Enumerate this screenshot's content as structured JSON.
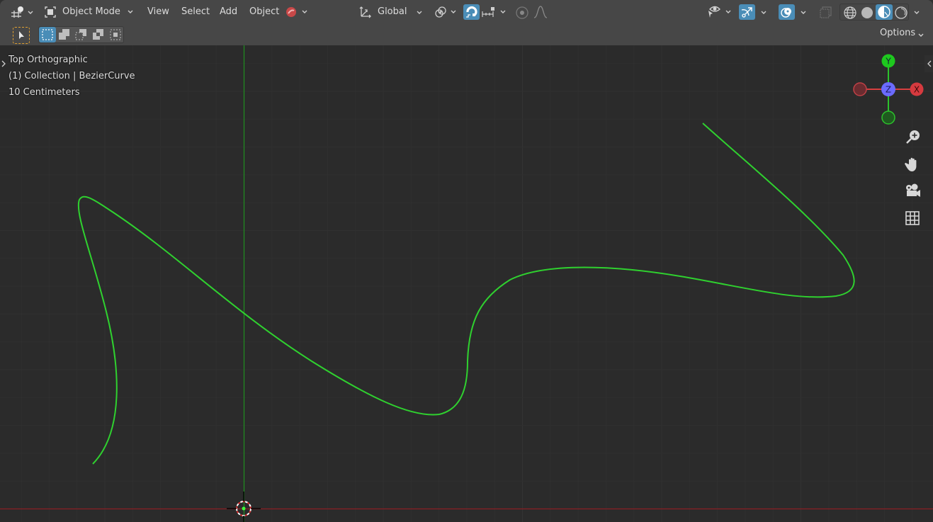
{
  "header": {
    "editor_type_icon": "viewport-editor-icon",
    "mode": {
      "label": "Object Mode",
      "icon": "object-mode-icon"
    },
    "menus": [
      "View",
      "Select",
      "Add",
      "Object"
    ],
    "transform_orientation": {
      "label": "Global",
      "icon": "orientation-icon"
    },
    "snap": {
      "active": true
    },
    "proportional_editing": {
      "active": false
    },
    "visibility_icon": "eye-icon",
    "gizmo_toggle": {
      "active": true
    },
    "overlay_toggle": {
      "active": true
    },
    "xray_toggle": {
      "active": false
    },
    "shading_modes": [
      {
        "name": "wireframe",
        "active": false
      },
      {
        "name": "solid",
        "active": false
      },
      {
        "name": "material-preview",
        "active": true
      },
      {
        "name": "rendered",
        "active": false
      }
    ],
    "options_label": "Options",
    "select_modes": [
      {
        "name": "set",
        "active": true
      },
      {
        "name": "extend",
        "active": false
      },
      {
        "name": "subtract",
        "active": false
      },
      {
        "name": "invert",
        "active": false
      },
      {
        "name": "intersect",
        "active": false
      }
    ]
  },
  "viewport": {
    "view_name": "Top Orthographic",
    "collection_info": "(1) Collection | BezierCurve",
    "grid_scale": "10 Centimeters",
    "gizmo": {
      "y_label": "Y",
      "z_label": "Z",
      "x_label": "X"
    },
    "nav_tools": [
      "zoom",
      "pan",
      "camera",
      "ortho-toggle"
    ],
    "colors": {
      "curve": "#2fd12f",
      "y_axis": "#1e8f1e",
      "x_axis": "#8a1f24",
      "accent": "#4a8db7"
    }
  }
}
